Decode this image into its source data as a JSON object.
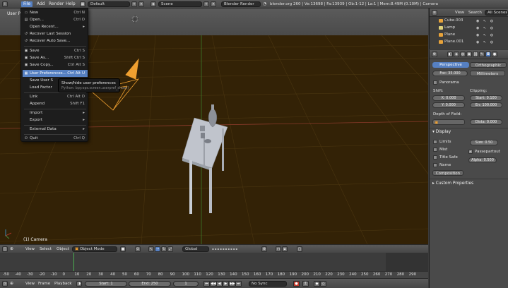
{
  "topbar": {
    "menus": [
      "File",
      "Add",
      "Render",
      "Help"
    ],
    "screen_layout": "Default",
    "scene": "Scene",
    "render_engine": "Blender Render",
    "stats": "blender.org 260 | Ve:13698 | Fa:13939 | Ob:1-12 | La:1 | Mem:8.49M (0.10M) | Camera"
  },
  "viewport": {
    "label_partial": "User Pe",
    "object_label": "(1) Camera"
  },
  "file_menu": {
    "items": [
      {
        "label": "New",
        "shortcut": "Ctrl N",
        "icon": "new-file-icon"
      },
      {
        "label": "Open...",
        "shortcut": "Ctrl O",
        "icon": "open-folder-icon"
      },
      {
        "label": "Open Recent...",
        "shortcut": "▸",
        "icon": ""
      },
      {
        "label": "Recover Last Session",
        "shortcut": "",
        "icon": "recover-icon"
      },
      {
        "label": "Recover Auto Save...",
        "shortcut": "",
        "icon": "recover-icon"
      },
      {
        "label": "Save",
        "shortcut": "Ctrl S",
        "icon": "save-icon"
      },
      {
        "label": "Save As...",
        "shortcut": "Shift Ctrl S",
        "icon": "save-icon"
      },
      {
        "label": "Save Copy...",
        "shortcut": "Ctrl Alt S",
        "icon": "save-icon"
      },
      {
        "label": "User Preferences...",
        "shortcut": "Ctrl Alt U",
        "icon": "preferences-icon"
      },
      {
        "label": "Save User S",
        "shortcut": "",
        "icon": ""
      },
      {
        "label": "Load Factor",
        "shortcut": "",
        "icon": ""
      },
      {
        "label": "Link",
        "shortcut": "Ctrl Alt O",
        "icon": ""
      },
      {
        "label": "Append",
        "shortcut": "Shift F1",
        "icon": ""
      },
      {
        "label": "Import",
        "shortcut": "▸",
        "icon": ""
      },
      {
        "label": "Export",
        "shortcut": "▸",
        "icon": ""
      },
      {
        "label": "External Data",
        "shortcut": "▸",
        "icon": ""
      },
      {
        "label": "Quit",
        "shortcut": "Ctrl Q",
        "icon": "quit-icon"
      }
    ],
    "highlighted": "User Preferences..."
  },
  "tooltip": {
    "title": "Show/hide user preferences",
    "python": "Python: bpy.ops.screen.userpref_show()"
  },
  "outliner": {
    "view_label": "View",
    "search_label": "Search",
    "filter": "All Scenes",
    "rows": [
      {
        "name": "Cube.003",
        "color": "#e8a33a"
      },
      {
        "name": "Lamp",
        "color": "#e0d27a"
      },
      {
        "name": "Plane",
        "color": "#e8a33a"
      },
      {
        "name": "Plane.001",
        "color": "#e8a33a"
      }
    ]
  },
  "properties": {
    "lens_type": {
      "perspective": "Perspective",
      "orthographic": "Orthographic"
    },
    "focal": "Foc: 35.000",
    "units": "Millimeters",
    "panorama": "Panorama",
    "shift": {
      "label": "Shift:",
      "x": "X: 0.000",
      "y": "Y: 0.000"
    },
    "clipping": {
      "label": "Clipping:",
      "start": "Start: 0.100",
      "end": "En: 100.000"
    },
    "dof": {
      "label": "Depth of Field:",
      "distance": "Dista: 0.000"
    },
    "display": {
      "header": "Display",
      "limits": "Limits",
      "mist": "Mist",
      "title_safe": "Title Safe",
      "name": "Name",
      "size": "Size: 0.50",
      "passepartout": "Passepartout",
      "alpha": "Alpha: 0.500",
      "composition": "Composition"
    },
    "custom_properties": "Custom Properties"
  },
  "viewport_header": {
    "view": "View",
    "select": "Select",
    "object": "Object",
    "mode": "Object Mode",
    "orientation": "Global"
  },
  "timeline": {
    "ticks": [
      "-50",
      "-40",
      "-30",
      "-20",
      "-10",
      "0",
      "10",
      "20",
      "30",
      "40",
      "50",
      "60",
      "70",
      "80",
      "90",
      "100",
      "110",
      "120",
      "130",
      "140",
      "150",
      "160",
      "170",
      "180",
      "190",
      "200",
      "210",
      "220",
      "230",
      "240",
      "250",
      "260",
      "270",
      "280",
      "290"
    ],
    "current_frame": "1",
    "start": "Start: 1",
    "end": "End: 250",
    "frame": "1",
    "sync": "No Sync",
    "header": {
      "view": "View",
      "frame": "Frame",
      "playback": "Playback"
    }
  }
}
